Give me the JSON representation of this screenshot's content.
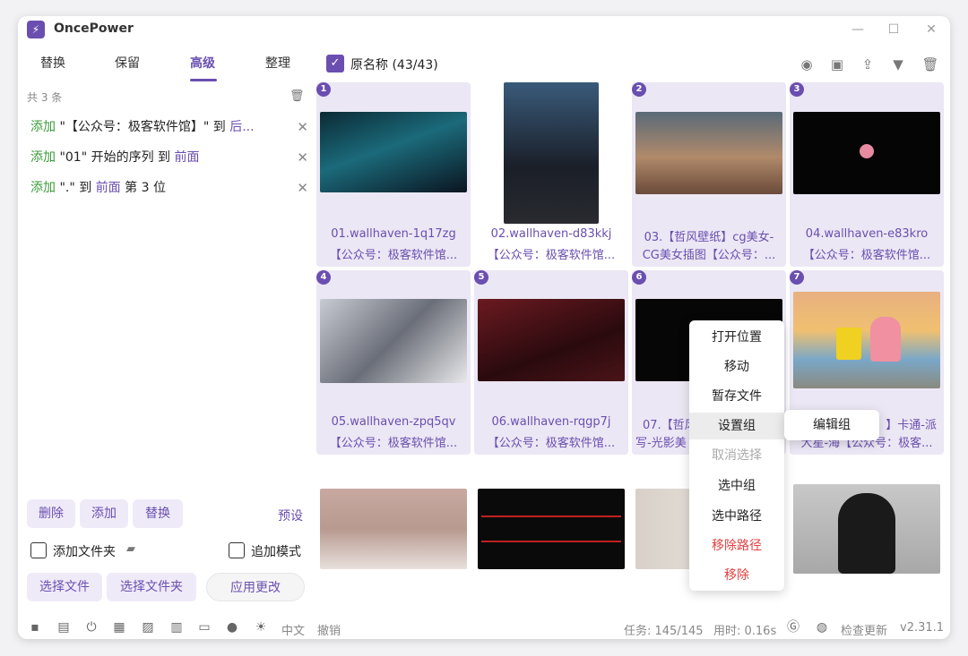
{
  "app": {
    "title": "OncePower",
    "logo": "lightning-icon",
    "version": "v2.31.1"
  },
  "tabs": [
    "替换",
    "保留",
    "高级",
    "整理"
  ],
  "active_tab": "高级",
  "rules": {
    "count_text": "共 3 条",
    "items": [
      {
        "action": "添加",
        "text": " \"【公众号：极客软件馆】\" 到 ",
        "target": "后..."
      },
      {
        "action": "添加",
        "text": "  \"01\" 开始的序列 到 ",
        "target": "前面"
      },
      {
        "action": "添加",
        "text": " \".\" 到 ",
        "target": "前面",
        "tail": " 第 3 位"
      }
    ]
  },
  "buttons": {
    "delete": "删除",
    "add": "添加",
    "replace": "替换",
    "preset": "预设",
    "add_folder": "添加文件夹",
    "append_mode": "追加模式",
    "select_files": "选择文件",
    "select_folder": "选择文件夹",
    "apply": "应用更改"
  },
  "header": {
    "original_name": "原名称 (43/43)"
  },
  "files": [
    {
      "num": "1",
      "name": "01.wallhaven-1q17zg",
      "sub": "【公众号：极客软件馆...",
      "color": "#1b6a7a"
    },
    {
      "num": "",
      "name": "02.wallhaven-d83kkj",
      "sub": "【公众号：极客软件馆...",
      "color": "#2a3a4a"
    },
    {
      "num": "2",
      "name": "03.【哲风壁纸】cg美女-",
      "sub": "CG美女插图【公众号：...",
      "color": "#8a7a6a"
    },
    {
      "num": "3",
      "name": "04.wallhaven-e83kro",
      "sub": "【公众号：极客软件馆...",
      "color": "#050505"
    },
    {
      "num": "4",
      "name": "05.wallhaven-zpq5qv",
      "sub": "【公众号：极客软件馆...",
      "color": "#7a7d85"
    },
    {
      "num": "5",
      "name": "06.wallhaven-rqgp7j",
      "sub": "【公众号：极客软件馆...",
      "color": "#4a1418"
    },
    {
      "num": "6",
      "name": "07.【哲风",
      "sub": "写-光影美",
      "color": "#050505"
    },
    {
      "num": "7",
      "name": "】卡通-派",
      "sub": "大星-海【公众号：极客...",
      "color": "#d8a070"
    },
    {
      "num": "",
      "name": "",
      "sub": "",
      "color": "#b89a90"
    },
    {
      "num": "",
      "name": "",
      "sub": "",
      "color": "#0a0a0a"
    },
    {
      "num": "",
      "name": "",
      "sub": "",
      "color": "#d8d0c8"
    },
    {
      "num": "",
      "name": "",
      "sub": "",
      "color": "#a8a8a8"
    }
  ],
  "context_menu": [
    "打开位置",
    "移动",
    "暂存文件",
    "设置组",
    "取消选择",
    "选中组",
    "选中路径",
    "移除路径",
    "移除"
  ],
  "submenu": "编辑组",
  "status": {
    "lang": "中文",
    "undo": "撤销",
    "tasks": "任务: 145/145",
    "time": "用时: 0.16s",
    "check_update": "检查更新"
  }
}
